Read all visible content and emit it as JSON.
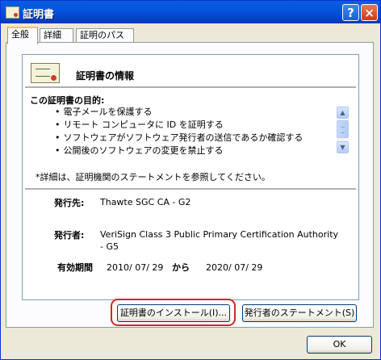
{
  "window": {
    "title": "証明書",
    "help_glyph": "?",
    "close_glyph": "×"
  },
  "tabs": [
    "全般",
    "詳細",
    "証明のパス"
  ],
  "info_title": "証明書の情報",
  "purpose": {
    "title": "この証明書の目的:",
    "items": [
      "電子メールを保護する",
      "リモート コンピュータに ID を証明する",
      "ソフトウェアがソフトウェア発行者の送信であるか確認する",
      "公開後のソフトウェアの変更を禁止する"
    ]
  },
  "note": "*詳細は、証明機関のステートメントを参照してください。",
  "issued_to": {
    "label": "発行先:",
    "value": "Thawte SGC CA - G2"
  },
  "issued_by": {
    "label": "発行者:",
    "value_line1": "VeriSign Class 3 Public Primary Certification Authority",
    "value_line2": "- G5"
  },
  "validity": {
    "label": "有効期間",
    "from": "2010/ 07/ 29",
    "to_word": "から",
    "to": "2020/ 07/ 29"
  },
  "buttons": {
    "install": "証明書のインストール(I)...",
    "issuer_statement": "発行者のステートメント(S)",
    "ok": "OK"
  },
  "colors": {
    "highlight": "#cc2b22",
    "titlebar": "#0454e0"
  }
}
